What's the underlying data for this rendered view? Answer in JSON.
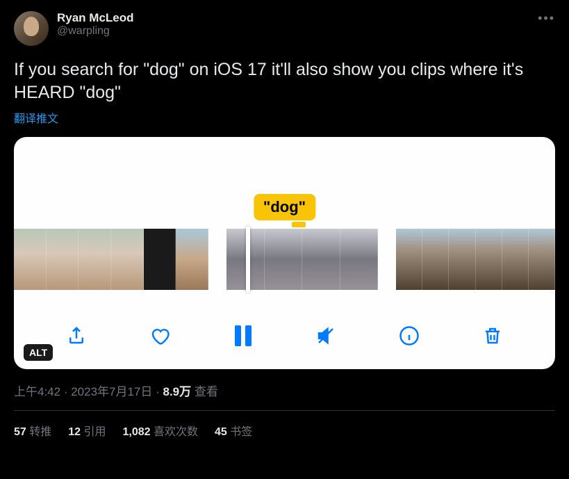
{
  "author": {
    "display_name": "Ryan McLeod",
    "handle": "@warpling"
  },
  "tweet_text": "If you search for \"dog\" on iOS 17 it'll also show you clips where it's HEARD \"dog\"",
  "translate_label": "翻译推文",
  "media": {
    "caption_text": "\"dog\"",
    "alt_badge": "ALT"
  },
  "meta": {
    "time": "上午4:42",
    "dot": " · ",
    "date": "2023年7月17日",
    "views_count": "8.9万",
    "views_label": " 查看"
  },
  "stats": {
    "retweets_count": "57",
    "retweets_label": " 转推",
    "quotes_count": "12",
    "quotes_label": " 引用",
    "likes_count": "1,082",
    "likes_label": " 喜欢次数",
    "bookmarks_count": "45",
    "bookmarks_label": " 书签"
  }
}
